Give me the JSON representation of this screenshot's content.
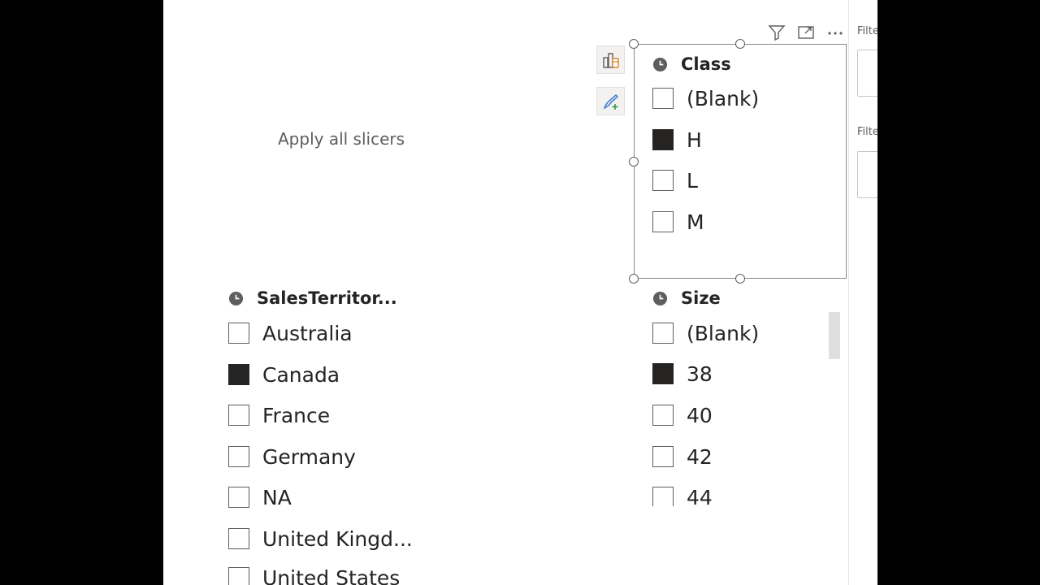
{
  "canvas": {
    "apply_all_label": "Apply all slicers",
    "class_slicer": {
      "title": "Class",
      "items": [
        {
          "label": "(Blank)",
          "checked": false
        },
        {
          "label": "H",
          "checked": true
        },
        {
          "label": "L",
          "checked": false
        },
        {
          "label": "M",
          "checked": false
        }
      ]
    },
    "territory_slicer": {
      "title": "SalesTerritor...",
      "items": [
        {
          "label": "Australia",
          "checked": false
        },
        {
          "label": "Canada",
          "checked": true
        },
        {
          "label": "France",
          "checked": false
        },
        {
          "label": "Germany",
          "checked": false
        },
        {
          "label": "NA",
          "checked": false
        },
        {
          "label": "United Kingd...",
          "checked": false
        },
        {
          "label": "United States",
          "checked": false
        }
      ]
    },
    "size_slicer": {
      "title": "Size",
      "items": [
        {
          "label": "(Blank)",
          "checked": false
        },
        {
          "label": "38",
          "checked": true
        },
        {
          "label": "40",
          "checked": false
        },
        {
          "label": "42",
          "checked": false
        },
        {
          "label": "44",
          "checked": false
        }
      ]
    }
  },
  "filter_pane": {
    "labels": [
      "Filte",
      "Filte"
    ]
  },
  "icons": {
    "visual_header": [
      "filter-icon",
      "focus-mode-icon",
      "more-options-icon"
    ],
    "side_buttons": [
      "visual-table-icon",
      "format-brush-icon"
    ],
    "slicer_header": "clock-icon"
  },
  "colors": {
    "checked_fill": "#252423",
    "checkbox_border": "#605e5c",
    "text": "#252423",
    "muted_text": "#605e5c",
    "accent_orange": "#d9852f",
    "accent_blue": "#3a7bd5",
    "accent_green": "#2e9e44"
  }
}
